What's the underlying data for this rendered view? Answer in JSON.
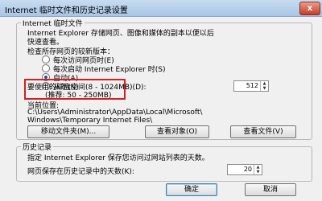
{
  "window": {
    "title": "Internet 临时文件和历史记录设置",
    "close_glyph": "x"
  },
  "temp_files": {
    "group_title": "Internet 临时文件",
    "description_line1": "Internet Explorer 存储网页、图像和媒体的副本以便以后",
    "description_line2": "快速查看。",
    "check_label": "检查所存网页的较新版本：",
    "options": [
      {
        "label": "每次访问网页时(E)",
        "checked": false
      },
      {
        "label": "每次启动 Internet Explorer 时(S)",
        "checked": false
      },
      {
        "label": "自动(A)",
        "checked": true
      },
      {
        "label": "从不(N)",
        "checked": false
      }
    ],
    "disk_space_label": "要使用的磁盘空间(8 - 1024MB)(D):",
    "disk_space_value": "512",
    "recommended": "(推荐: 50 - 250MB)",
    "location_label": "当前位置:",
    "location_line1": "C:\\Users\\Administrator\\AppData\\Local\\Microsoft\\",
    "location_line2": "Windows\\Temporary Internet Files\\",
    "buttons": {
      "move_folder": "移动文件夹(M)...",
      "view_objects": "查看对象(O)",
      "view_files": "查看文件(V)"
    }
  },
  "history": {
    "group_title": "历史记录",
    "description": "指定 Internet Explorer 保存您访问过网站列表的天数。",
    "days_label": "网页保存在历史记录中的天数(K):",
    "days_value": "20"
  },
  "footer": {
    "ok": "确定",
    "cancel": "取消"
  }
}
